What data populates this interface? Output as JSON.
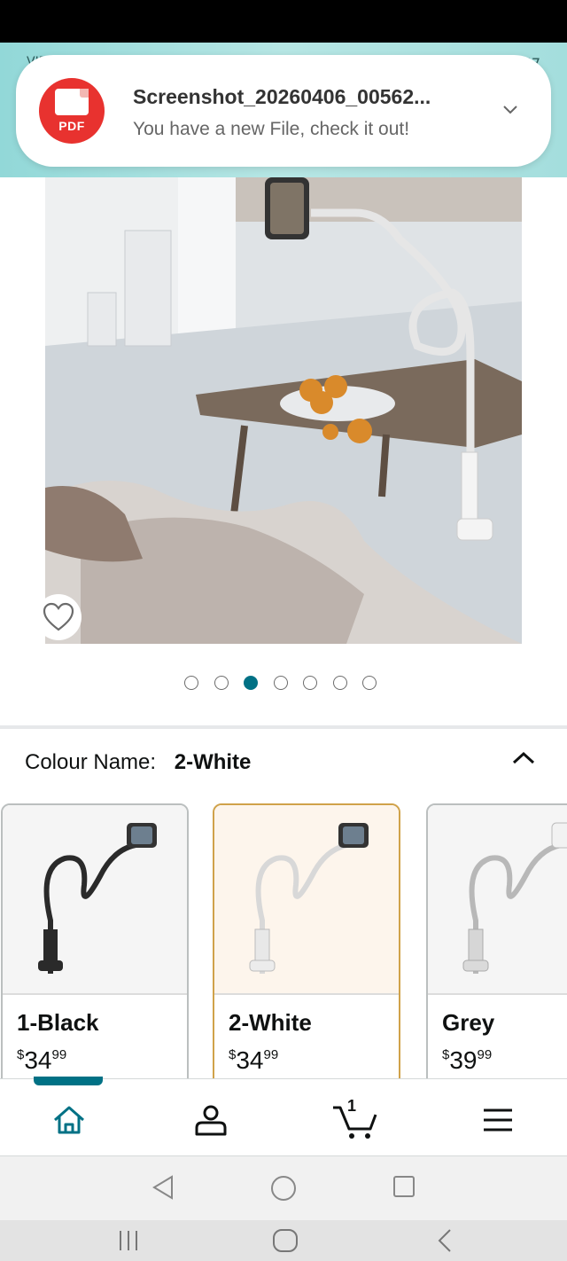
{
  "status_bar": {
    "left": "VIP",
    "right": "57"
  },
  "notification": {
    "icon_label": "PDF",
    "title": "Screenshot_20260406_00562...",
    "body": "You have a new File, check it out!",
    "expand_icon": "chevron-down-icon"
  },
  "gallery": {
    "image_count": 7,
    "active_index": 2,
    "wishlist_icon": "heart-icon"
  },
  "colour": {
    "label": "Colour Name:",
    "selected": "2-White",
    "collapse_icon": "chevron-up-icon"
  },
  "swatches": [
    {
      "name": "1-Black",
      "currency": "$",
      "whole": "34",
      "cents": "99"
    },
    {
      "name": "2-White",
      "currency": "$",
      "whole": "34",
      "cents": "99"
    },
    {
      "name": "Grey",
      "currency": "$",
      "whole": "39",
      "cents": "99"
    }
  ],
  "bottom_nav": {
    "items": [
      "home-icon",
      "account-icon",
      "cart-icon",
      "menu-icon"
    ],
    "cart_count": "1",
    "active_color": "#007185"
  },
  "colors": {
    "accent": "#007185",
    "selected_border": "#d0a24a"
  }
}
